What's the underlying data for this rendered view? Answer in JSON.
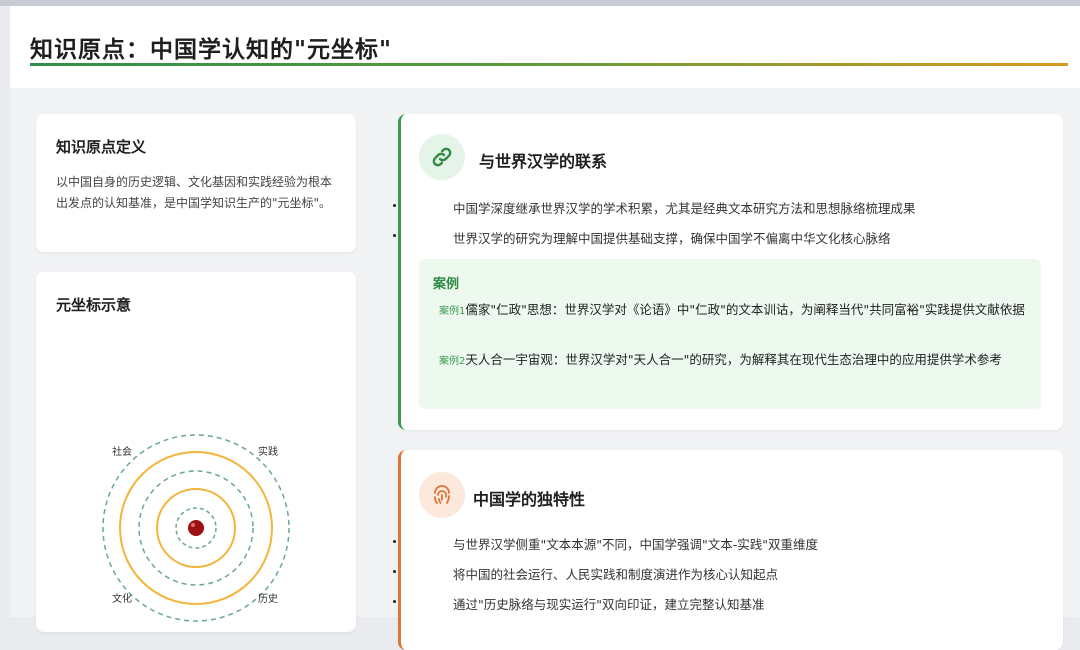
{
  "header": {
    "title": "知识原点：中国学认知的\"元坐标\""
  },
  "definition": {
    "heading": "知识原点定义",
    "text": "以中国自身的历史逻辑、文化基因和实践经验为根本出发点的认知基准，是中国学知识生产的\"元坐标\"。"
  },
  "coordinate": {
    "heading": "元坐标示意",
    "labels": [
      "社会",
      "实践",
      "文化",
      "历史"
    ]
  },
  "link_section": {
    "icon": "link-icon",
    "title": "与世界汉学的联系",
    "bullets": [
      "中国学深度继承世界汉学的学术积累，尤其是经典文本研究方法和思想脉络梳理成果",
      "世界汉学的研究为理解中国提供基础支撑，确保中国学不偏离中华文化核心脉络"
    ],
    "case_heading": "案例",
    "cases": [
      {
        "tag": "案例1",
        "text": "儒家\"仁政\"思想：世界汉学对《论语》中\"仁政\"的文本训诂，为阐释当代\"共同富裕\"实践提供文献依据"
      },
      {
        "tag": "案例2",
        "text": "天人合一宇宙观：世界汉学对\"天人合一\"的研究，为解释其在现代生态治理中的应用提供学术参考"
      }
    ]
  },
  "unique_section": {
    "icon": "fingerprint-icon",
    "title": "中国学的独特性",
    "bullets": [
      "与世界汉学侧重\"文本本源\"不同，中国学强调\"文本-实践\"双重维度",
      "将中国的社会运行、人民实践和制度演进作为核心认知起点",
      "通过\"历史脉络与现实运行\"双向印证，建立完整认知基准"
    ]
  },
  "colors": {
    "green": "#3e9a52",
    "orange": "#e0733a",
    "ring_gold": "#f2b53a",
    "ring_teal": "#6aa69a",
    "center_red": "#9b1010"
  }
}
